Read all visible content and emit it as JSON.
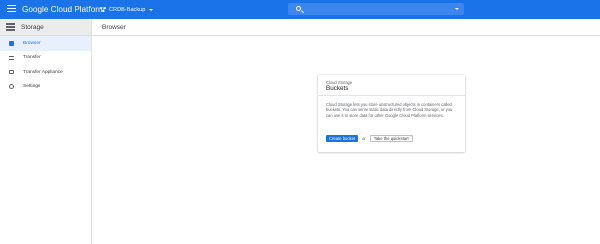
{
  "topbar": {
    "brand": "Google Cloud Platform",
    "project": "CRDB-Backup",
    "search_placeholder": "",
    "search_value": ""
  },
  "sidebar": {
    "title": "Storage",
    "items": [
      {
        "label": "Browser",
        "icon": "browser-icon",
        "active": true
      },
      {
        "label": "Transfer",
        "icon": "transfer-icon",
        "active": false
      },
      {
        "label": "Transfer Appliance",
        "icon": "transfer-appliance-icon",
        "active": false
      },
      {
        "label": "Settings",
        "icon": "settings-icon",
        "active": false
      }
    ]
  },
  "main": {
    "header": "Browser",
    "card": {
      "overline": "Cloud Storage",
      "title": "Buckets",
      "description": "Cloud Storage lets you store unstructured objects in containers called buckets. You can serve static data directly from Cloud Storage, or you can use it to store data for other Google Cloud Platform services.",
      "primary_button": "Create bucket",
      "or_text": "or",
      "secondary_button": "Take the quickstart"
    }
  },
  "colors": {
    "brand_blue": "#1a73e8",
    "search_bg": "#3b87ee",
    "sidebar_header_bg": "#ececec",
    "active_item_bg": "#e8f0fe"
  }
}
